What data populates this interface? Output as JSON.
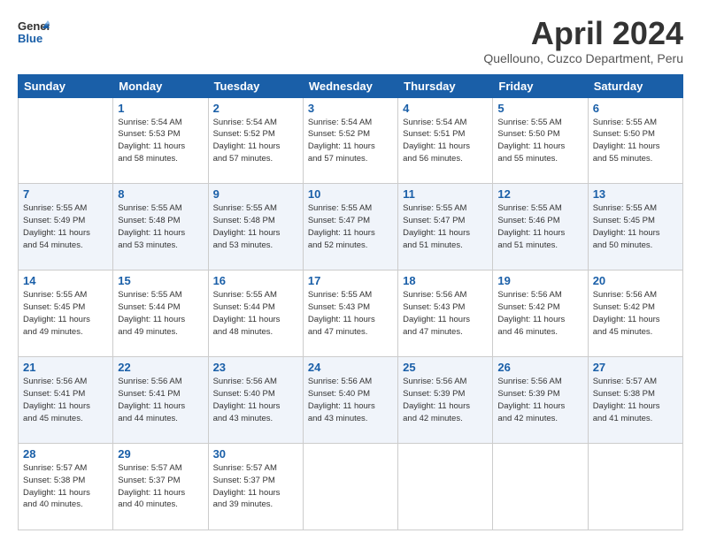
{
  "header": {
    "logo_general": "General",
    "logo_blue": "Blue",
    "title": "April 2024",
    "location": "Quellouno, Cuzco Department, Peru"
  },
  "days_of_week": [
    "Sunday",
    "Monday",
    "Tuesday",
    "Wednesday",
    "Thursday",
    "Friday",
    "Saturday"
  ],
  "weeks": [
    [
      {
        "day": "",
        "info": ""
      },
      {
        "day": "1",
        "info": "Sunrise: 5:54 AM\nSunset: 5:53 PM\nDaylight: 11 hours\nand 58 minutes."
      },
      {
        "day": "2",
        "info": "Sunrise: 5:54 AM\nSunset: 5:52 PM\nDaylight: 11 hours\nand 57 minutes."
      },
      {
        "day": "3",
        "info": "Sunrise: 5:54 AM\nSunset: 5:52 PM\nDaylight: 11 hours\nand 57 minutes."
      },
      {
        "day": "4",
        "info": "Sunrise: 5:54 AM\nSunset: 5:51 PM\nDaylight: 11 hours\nand 56 minutes."
      },
      {
        "day": "5",
        "info": "Sunrise: 5:55 AM\nSunset: 5:50 PM\nDaylight: 11 hours\nand 55 minutes."
      },
      {
        "day": "6",
        "info": "Sunrise: 5:55 AM\nSunset: 5:50 PM\nDaylight: 11 hours\nand 55 minutes."
      }
    ],
    [
      {
        "day": "7",
        "info": "Sunrise: 5:55 AM\nSunset: 5:49 PM\nDaylight: 11 hours\nand 54 minutes."
      },
      {
        "day": "8",
        "info": "Sunrise: 5:55 AM\nSunset: 5:48 PM\nDaylight: 11 hours\nand 53 minutes."
      },
      {
        "day": "9",
        "info": "Sunrise: 5:55 AM\nSunset: 5:48 PM\nDaylight: 11 hours\nand 53 minutes."
      },
      {
        "day": "10",
        "info": "Sunrise: 5:55 AM\nSunset: 5:47 PM\nDaylight: 11 hours\nand 52 minutes."
      },
      {
        "day": "11",
        "info": "Sunrise: 5:55 AM\nSunset: 5:47 PM\nDaylight: 11 hours\nand 51 minutes."
      },
      {
        "day": "12",
        "info": "Sunrise: 5:55 AM\nSunset: 5:46 PM\nDaylight: 11 hours\nand 51 minutes."
      },
      {
        "day": "13",
        "info": "Sunrise: 5:55 AM\nSunset: 5:45 PM\nDaylight: 11 hours\nand 50 minutes."
      }
    ],
    [
      {
        "day": "14",
        "info": "Sunrise: 5:55 AM\nSunset: 5:45 PM\nDaylight: 11 hours\nand 49 minutes."
      },
      {
        "day": "15",
        "info": "Sunrise: 5:55 AM\nSunset: 5:44 PM\nDaylight: 11 hours\nand 49 minutes."
      },
      {
        "day": "16",
        "info": "Sunrise: 5:55 AM\nSunset: 5:44 PM\nDaylight: 11 hours\nand 48 minutes."
      },
      {
        "day": "17",
        "info": "Sunrise: 5:55 AM\nSunset: 5:43 PM\nDaylight: 11 hours\nand 47 minutes."
      },
      {
        "day": "18",
        "info": "Sunrise: 5:56 AM\nSunset: 5:43 PM\nDaylight: 11 hours\nand 47 minutes."
      },
      {
        "day": "19",
        "info": "Sunrise: 5:56 AM\nSunset: 5:42 PM\nDaylight: 11 hours\nand 46 minutes."
      },
      {
        "day": "20",
        "info": "Sunrise: 5:56 AM\nSunset: 5:42 PM\nDaylight: 11 hours\nand 45 minutes."
      }
    ],
    [
      {
        "day": "21",
        "info": "Sunrise: 5:56 AM\nSunset: 5:41 PM\nDaylight: 11 hours\nand 45 minutes."
      },
      {
        "day": "22",
        "info": "Sunrise: 5:56 AM\nSunset: 5:41 PM\nDaylight: 11 hours\nand 44 minutes."
      },
      {
        "day": "23",
        "info": "Sunrise: 5:56 AM\nSunset: 5:40 PM\nDaylight: 11 hours\nand 43 minutes."
      },
      {
        "day": "24",
        "info": "Sunrise: 5:56 AM\nSunset: 5:40 PM\nDaylight: 11 hours\nand 43 minutes."
      },
      {
        "day": "25",
        "info": "Sunrise: 5:56 AM\nSunset: 5:39 PM\nDaylight: 11 hours\nand 42 minutes."
      },
      {
        "day": "26",
        "info": "Sunrise: 5:56 AM\nSunset: 5:39 PM\nDaylight: 11 hours\nand 42 minutes."
      },
      {
        "day": "27",
        "info": "Sunrise: 5:57 AM\nSunset: 5:38 PM\nDaylight: 11 hours\nand 41 minutes."
      }
    ],
    [
      {
        "day": "28",
        "info": "Sunrise: 5:57 AM\nSunset: 5:38 PM\nDaylight: 11 hours\nand 40 minutes."
      },
      {
        "day": "29",
        "info": "Sunrise: 5:57 AM\nSunset: 5:37 PM\nDaylight: 11 hours\nand 40 minutes."
      },
      {
        "day": "30",
        "info": "Sunrise: 5:57 AM\nSunset: 5:37 PM\nDaylight: 11 hours\nand 39 minutes."
      },
      {
        "day": "",
        "info": ""
      },
      {
        "day": "",
        "info": ""
      },
      {
        "day": "",
        "info": ""
      },
      {
        "day": "",
        "info": ""
      }
    ]
  ]
}
